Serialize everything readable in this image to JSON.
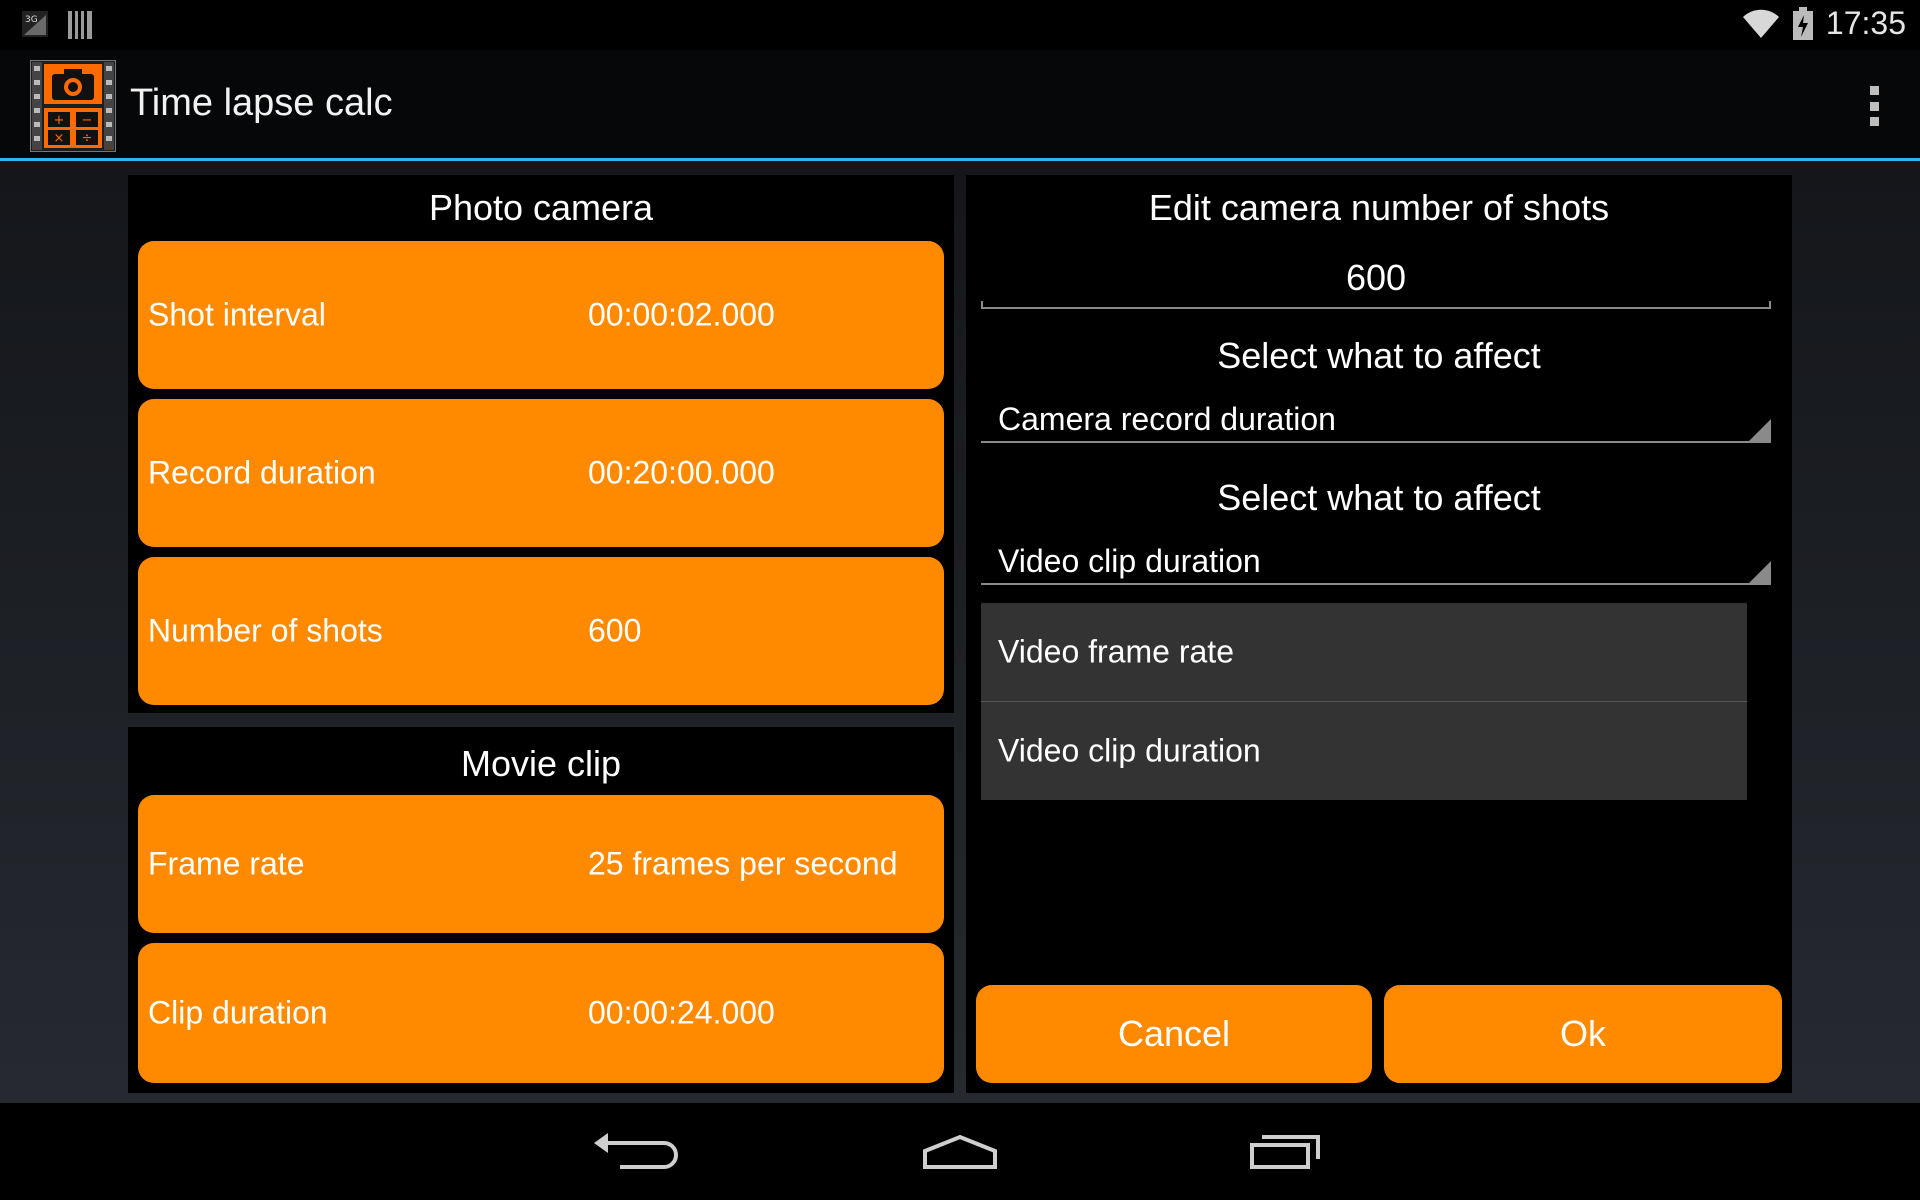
{
  "status_bar": {
    "time": "17:35",
    "network_label": "3G",
    "icons": [
      "signal-icon",
      "storage-icon",
      "wifi-icon",
      "battery-icon"
    ]
  },
  "app": {
    "title": "Time lapse calc",
    "icon": "camera-calculator-icon"
  },
  "photo_camera": {
    "title": "Photo camera",
    "rows": [
      {
        "label": "Shot interval",
        "value": "00:00:02.000"
      },
      {
        "label": "Record duration",
        "value": "00:20:00.000"
      },
      {
        "label": "Number of shots",
        "value": "600"
      }
    ]
  },
  "movie_clip": {
    "title": "Movie clip",
    "rows": [
      {
        "label": "Frame rate",
        "value": "25 frames per second"
      },
      {
        "label": "Clip duration",
        "value": "00:00:24.000"
      }
    ]
  },
  "dialog": {
    "title": "Edit camera number of shots",
    "shots_value": "600",
    "select1_label": "Select what to affect",
    "select1_value": "Camera record duration",
    "select2_label": "Select what to affect",
    "select2_value": "Video clip duration",
    "dropdown_options": [
      "Video frame rate",
      "Video clip duration"
    ],
    "cancel_label": "Cancel",
    "ok_label": "Ok"
  },
  "colors": {
    "accent": "#ff8a00",
    "action_bar_divider": "#33b5e5",
    "dropdown_bg": "#333333"
  }
}
